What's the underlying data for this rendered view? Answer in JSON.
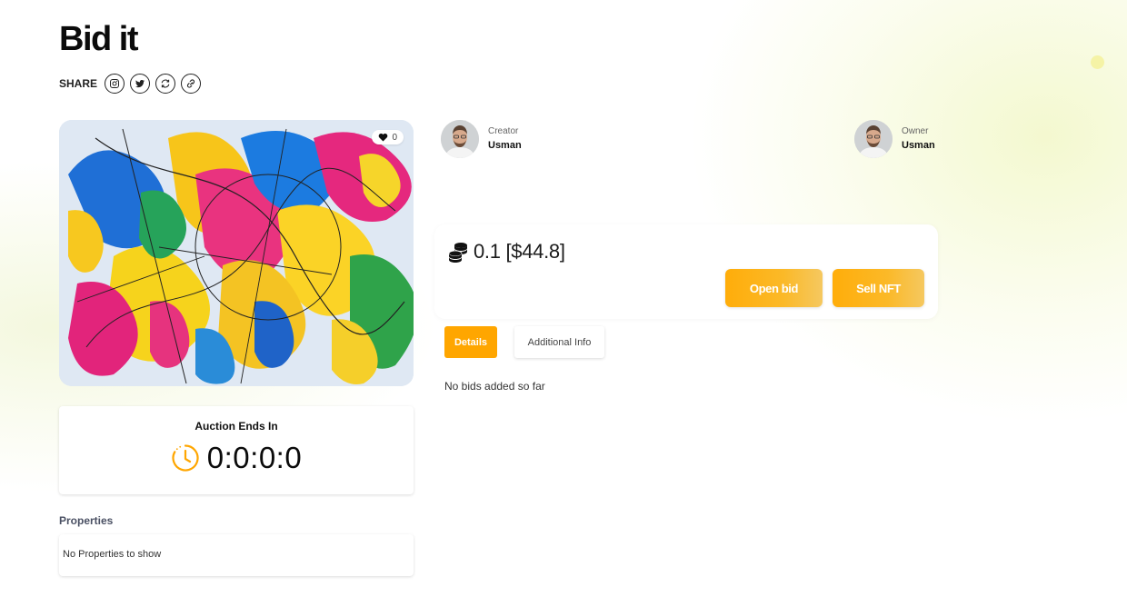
{
  "page": {
    "title": "Bid it"
  },
  "share": {
    "label": "SHARE",
    "buttons": [
      {
        "icon": "instagram-icon"
      },
      {
        "icon": "twitter-icon"
      },
      {
        "icon": "refresh-icon"
      },
      {
        "icon": "link-icon"
      }
    ]
  },
  "nft": {
    "likes": "0"
  },
  "auction": {
    "title": "Auction Ends In",
    "countdown": "0:0:0:0"
  },
  "properties": {
    "title": "Properties",
    "empty_text": "No Properties to show"
  },
  "creator": {
    "role": "Creator",
    "name": "Usman"
  },
  "owner": {
    "role": "Owner",
    "name": "Usman"
  },
  "price": {
    "value": "0.1 [$44.8]"
  },
  "actions": {
    "open_bid": "Open bid",
    "sell_nft": "Sell NFT"
  },
  "tabs": {
    "details": "Details",
    "additional_info": "Additional Info"
  },
  "bids": {
    "empty_text": "No bids added so far"
  },
  "colors": {
    "accent": "#ffa600",
    "button_gradient_start": "#ffad0a",
    "button_gradient_end": "#f5c860"
  }
}
